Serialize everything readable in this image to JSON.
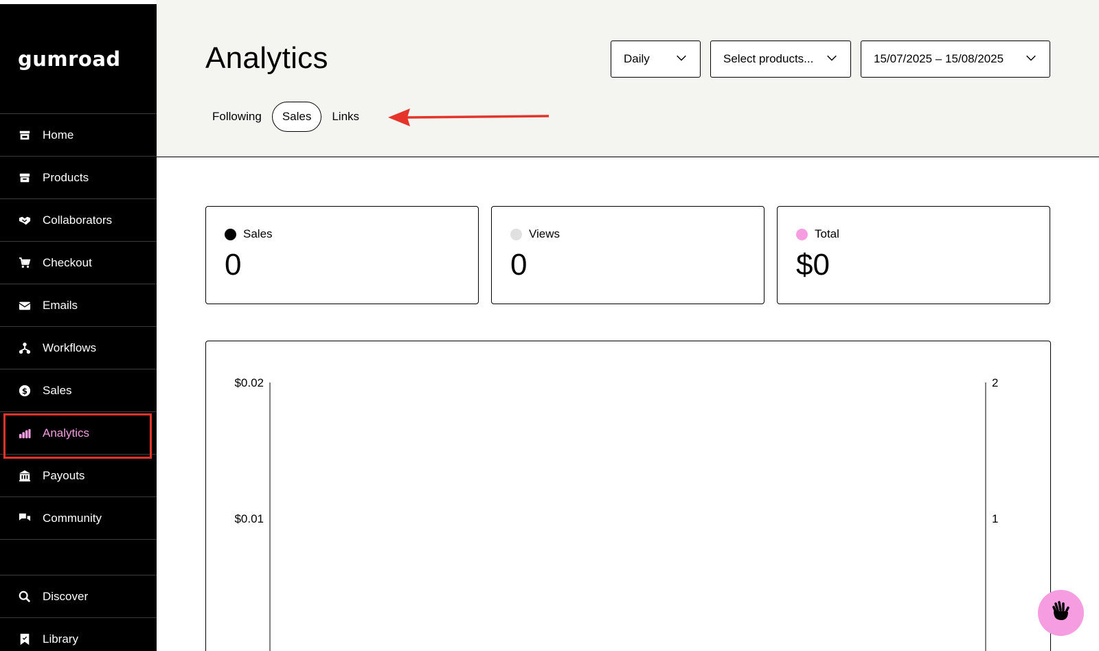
{
  "app": {
    "logo": "gumroad"
  },
  "sidebar": {
    "items": [
      {
        "label": "Home",
        "icon": "store-icon"
      },
      {
        "label": "Products",
        "icon": "archive-icon"
      },
      {
        "label": "Collaborators",
        "icon": "handshake-icon"
      },
      {
        "label": "Checkout",
        "icon": "cart-icon"
      },
      {
        "label": "Emails",
        "icon": "envelope-icon"
      },
      {
        "label": "Workflows",
        "icon": "workflow-icon"
      },
      {
        "label": "Sales",
        "icon": "dollar-circle-icon"
      },
      {
        "label": "Analytics",
        "icon": "bar-chart-icon",
        "active": true
      },
      {
        "label": "Payouts",
        "icon": "bank-icon"
      },
      {
        "label": "Community",
        "icon": "chat-icon"
      }
    ],
    "bottom_items": [
      {
        "label": "Discover",
        "icon": "search-icon"
      },
      {
        "label": "Library",
        "icon": "bookmark-icon"
      }
    ],
    "active_color": "#f59de0"
  },
  "header": {
    "title": "Analytics",
    "filters": {
      "period": "Daily",
      "products": "Select products...",
      "date_range": "15/07/2025 – 15/08/2025"
    },
    "tabs": [
      {
        "label": "Following"
      },
      {
        "label": "Sales",
        "active": true
      },
      {
        "label": "Links"
      }
    ]
  },
  "stats": [
    {
      "label": "Sales",
      "value": "0",
      "dot_color": "#000000"
    },
    {
      "label": "Views",
      "value": "0",
      "dot_color": "#e0e0e0"
    },
    {
      "label": "Total",
      "value": "$0",
      "dot_color": "#f59de0"
    }
  ],
  "chart_data": {
    "type": "line",
    "series": [],
    "y_left_ticks": [
      "$0.02",
      "$0.01"
    ],
    "y_right_ticks": [
      "2",
      "1"
    ],
    "ylim_left": [
      0,
      0.02
    ],
    "ylim_right": [
      0,
      2
    ]
  },
  "colors": {
    "accent_pink": "#f59de0",
    "header_bg": "#f4f4f0",
    "annotation_red": "#e5342a"
  }
}
